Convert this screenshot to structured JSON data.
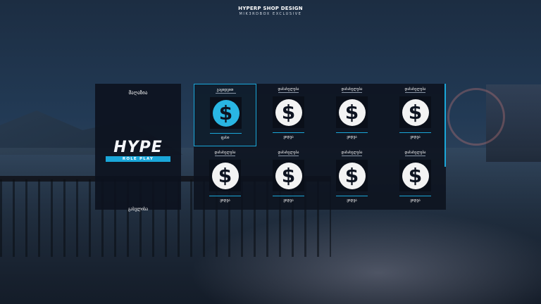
{
  "header": {
    "title": "HYPERP SHOP DESIGN",
    "subtitle": "MIK3RDBOX EXCLUSIVE"
  },
  "shop": {
    "title": "მაღაზია",
    "footer": "გასვლისა",
    "logo": {
      "main": "HYPE",
      "sub": "ROLE PLAY"
    }
  },
  "items": [
    {
      "label": "გაყიდვით",
      "price": "ფასი",
      "icon": "dollar-coin",
      "selected": true
    },
    {
      "label": "დასახელება",
      "price": "ყიდვა",
      "icon": "dollar-coin",
      "selected": false
    },
    {
      "label": "დასახელება",
      "price": "ყიდვა",
      "icon": "dollar-coin",
      "selected": false
    },
    {
      "label": "დასახელება",
      "price": "ყიდვა",
      "icon": "dollar-coin",
      "selected": false
    },
    {
      "label": "დასახელება",
      "price": "ყიდვა",
      "icon": "dollar-coin",
      "selected": false
    },
    {
      "label": "დასახელება",
      "price": "ყიდვა",
      "icon": "dollar-coin",
      "selected": false
    },
    {
      "label": "დასახელება",
      "price": "ყიდვა",
      "icon": "dollar-coin",
      "selected": false
    },
    {
      "label": "დასახელება",
      "price": "ყიდვა",
      "icon": "dollar-coin",
      "selected": false
    }
  ],
  "colors": {
    "accent": "#1aa7d9",
    "panel": "#0c121e",
    "coin": "#f3f3f3",
    "coin_selected": "#29b6e3"
  }
}
